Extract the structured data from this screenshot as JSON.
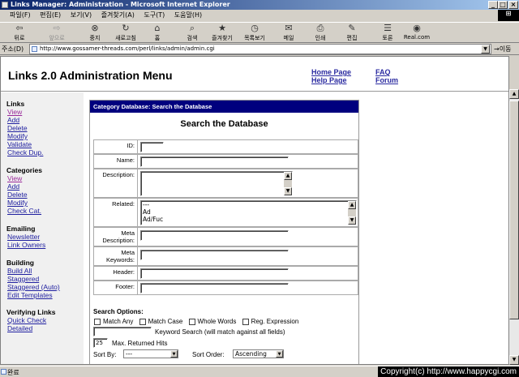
{
  "window": {
    "title": "Links Manager: Administration - Microsoft Internet Explorer",
    "controls": [
      "_",
      "□",
      "×"
    ]
  },
  "menubar": {
    "items": [
      "파일(F)",
      "편집(E)",
      "보기(V)",
      "즐겨찾기(A)",
      "도구(T)",
      "도움말(H)"
    ]
  },
  "toolbar": {
    "buttons": [
      {
        "label": "뒤로",
        "icon": "back-arrow-icon"
      },
      {
        "label": "앞으로",
        "icon": "forward-arrow-icon"
      },
      {
        "label": "중지",
        "icon": "stop-icon"
      },
      {
        "label": "새로고침",
        "icon": "refresh-icon"
      },
      {
        "label": "홈",
        "icon": "home-icon"
      },
      {
        "label": "검색",
        "icon": "search-icon"
      },
      {
        "label": "즐겨찾기",
        "icon": "favorites-icon"
      },
      {
        "label": "목록보기",
        "icon": "history-icon"
      },
      {
        "label": "메일",
        "icon": "mail-icon"
      },
      {
        "label": "인쇄",
        "icon": "print-icon"
      },
      {
        "label": "편집",
        "icon": "edit-icon"
      },
      {
        "label": "토론",
        "icon": "discuss-icon"
      },
      {
        "label": "Real.com",
        "icon": "realcom-icon"
      }
    ]
  },
  "addressbar": {
    "label": "주소(D)",
    "url": "http://www.gossamer-threads.com/perl/links/admin/admin.cgi",
    "go_label": "이동"
  },
  "header": {
    "title": "Links 2.0 Administration Menu",
    "links": [
      "Home Page",
      "Help Page",
      "FAQ",
      "Forum"
    ]
  },
  "sidebar": {
    "links_title": "Links",
    "links_items": [
      "View",
      "Add",
      "Delete",
      "Modify",
      "Validate",
      "Check Dup."
    ],
    "categories_title": "Categories",
    "categories_items": [
      "View",
      "Add",
      "Delete",
      "Modify",
      "Check Cat."
    ],
    "emailing_title": "Emailing",
    "emailing_items": [
      "Newsletter",
      "Link Owners"
    ],
    "building_title": "Building",
    "building_items": [
      "Build All",
      "Staggered",
      "Staggered (Auto)",
      "Edit Templates"
    ],
    "verifying_title": "Verifying Links",
    "verifying_items": [
      "Quick Check",
      "Detailed"
    ]
  },
  "panel": {
    "heading": "Category Database: Search the Database",
    "title": "Search the Database",
    "fields": {
      "id": "ID:",
      "name": "Name:",
      "description": "Description:",
      "related": "Related:",
      "meta_description": "Meta Description:",
      "meta_keywords": "Meta Keywords:",
      "header": "Header:",
      "footer": "Footer:"
    },
    "related_options": [
      "---",
      "Ad",
      "Ad/Fuc"
    ],
    "search_options_label": "Search Options:",
    "checkboxes": [
      "Match Any",
      "Match Case",
      "Whole Words",
      "Reg. Expression"
    ],
    "keyword_label": "Keyword Search (will match against all fields)",
    "max_hits_value": "25",
    "max_hits_label": "Max. Returned Hits",
    "sort_by_label": "Sort By:",
    "sort_by_value": "---",
    "sort_order_label": "Sort Order:",
    "sort_order_value": "Ascending"
  },
  "status": {
    "text": "완료"
  },
  "copyright": "Copyright(c) http://www.happycgi.com"
}
